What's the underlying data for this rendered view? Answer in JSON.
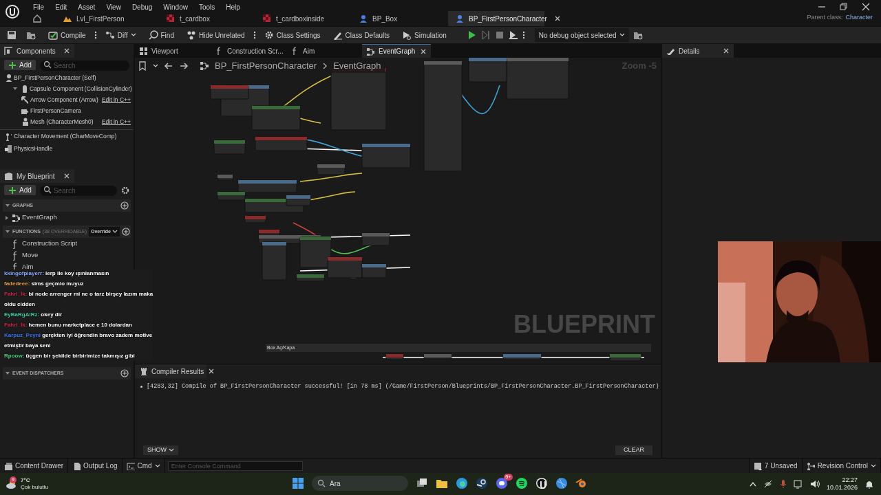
{
  "menu": [
    "File",
    "Edit",
    "Asset",
    "View",
    "Debug",
    "Window",
    "Tools",
    "Help"
  ],
  "doc_tabs": [
    {
      "label": "Lvl_FirstPerson",
      "kind": "level",
      "selected": false
    },
    {
      "label": "t_cardbox",
      "kind": "texture",
      "selected": false
    },
    {
      "label": "t_cardboxinside",
      "kind": "texture",
      "selected": false
    },
    {
      "label": "BP_Box",
      "kind": "blueprint",
      "selected": false
    },
    {
      "label": "BP_FirstPersonCharacter",
      "kind": "blueprint",
      "selected": true
    }
  ],
  "parent_class": {
    "label": "Parent class:",
    "value": "Character"
  },
  "toolbar": [
    {
      "label": "Compile",
      "kind": "compile"
    },
    {
      "label": "Diff",
      "kind": "diff"
    },
    {
      "label": "Find",
      "kind": "find"
    },
    {
      "label": "Hide Unrelated",
      "kind": "hide"
    },
    {
      "label": "Class Settings",
      "kind": "settings"
    },
    {
      "label": "Class Defaults",
      "kind": "defaults"
    },
    {
      "label": "Simulation",
      "kind": "simulation"
    }
  ],
  "debug_select": "No debug object selected",
  "components": {
    "title": "Components",
    "add": "Add",
    "search_placeholder": "Search",
    "tree": [
      {
        "label": "BP_FirstPersonCharacter (Self)",
        "children": [
          {
            "label": "Capsule Component (CollisionCylinder)",
            "expanded": true,
            "children": [
              {
                "label": "Arrow Component (Arrow)",
                "edit": "Edit in C++"
              },
              {
                "label": "FirstPersonCamera"
              },
              {
                "label": "Mesh (CharacterMesh0)",
                "edit": "Edit in C++"
              }
            ]
          }
        ]
      },
      {
        "label": "Character Movement (CharMoveComp)",
        "separated": true
      },
      {
        "label": "PhysicsHandle"
      }
    ]
  },
  "my_blueprint": {
    "title": "My Blueprint",
    "add": "Add",
    "search_placeholder": "Search",
    "graphs_header": "GRAPHS",
    "graphs": [
      "EventGraph"
    ],
    "functions_header": "FUNCTIONS",
    "functions_note": "(38 OVERRIDABLE)",
    "override": "Override",
    "functions": [
      "Construction Script",
      "Move",
      "Aim"
    ],
    "event_dispatchers": "EVENT DISPATCHERS"
  },
  "chat": [
    {
      "user": "kkingofplayerr:",
      "color": "#8ea6ff",
      "text": "lerp ile koy ışınlanmasın"
    },
    {
      "user": "fadedeee:",
      "color": "#f0a040",
      "text": "sims geçmio muyuz"
    },
    {
      "user": "Fahri_İk:",
      "color": "#d02848",
      "text": "bi node arrenger mi ne o tarz birşey lazım maka"
    },
    {
      "text": "oldu cidden"
    },
    {
      "user": "EyBaRgAlRz:",
      "color": "#3cc8a0",
      "text": "okey dir"
    },
    {
      "user": "Fahri_İk:",
      "color": "#d02848",
      "text": "hemen bunu marketplace e 10 dolardan"
    },
    {
      "user": "Karpuz_Peyni",
      "color": "#3a78f0",
      "text": "gerçkten iyi öğrendin bravo zadem motive"
    },
    {
      "text": "etmiştir baya seni"
    },
    {
      "user": "Rpoow:",
      "color": "#50d080",
      "text": "üçgen bir şekilde birbirimize takmışız gibi"
    }
  ],
  "graph_tabs": [
    {
      "label": "Viewport",
      "kind": "viewport",
      "selected": false
    },
    {
      "label": "Construction Scr...",
      "kind": "function",
      "selected": false
    },
    {
      "label": "Aim",
      "kind": "function",
      "selected": false
    },
    {
      "label": "EventGraph",
      "kind": "graph",
      "selected": true
    }
  ],
  "breadcrumb": [
    "BP_FirstPersonCharacter",
    "EventGraph"
  ],
  "zoom": "Zoom -5",
  "comment": "Box Aç/Kapa",
  "watermark": "BLUEPRINT",
  "details": {
    "title": "Details"
  },
  "compiler": {
    "title": "Compiler Results",
    "messages": [
      "[4283,32] Compile of BP_FirstPersonCharacter successful! [in 78 ms] (/Game/FirstPerson/Blueprints/BP_FirstPersonCharacter.BP_FirstPersonCharacter)"
    ],
    "show": "SHOW",
    "clear": "CLEAR"
  },
  "status_bar": {
    "content_drawer": "Content Drawer",
    "output_log": "Output Log",
    "cmd": "Cmd",
    "console_placeholder": "Enter Console Command",
    "unsaved": "7 Unsaved",
    "revision": "Revision Control"
  },
  "taskbar": {
    "weather_badge": "9",
    "temp": "7°C",
    "weather": "Çok bulutlu",
    "search": "Ara",
    "discord_badge": "9+",
    "time": "22:27",
    "date": "10.01.2026"
  }
}
